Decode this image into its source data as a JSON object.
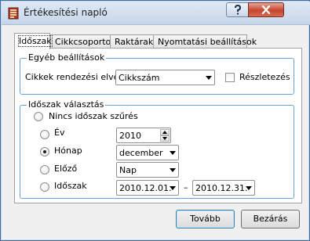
{
  "window": {
    "title": "Értékesítési napló"
  },
  "tabs": [
    {
      "label": "Időszak"
    },
    {
      "label": "Cikkcsoportok"
    },
    {
      "label": "Raktárak"
    },
    {
      "label": "Nyomtatási beállítások"
    }
  ],
  "other_settings": {
    "title": "Egyéb beállítások",
    "sort_label": "Cikkek rendezési elve :",
    "sort_value": "Cikkszám",
    "detail_label": "Részletezés",
    "detail_checked": false
  },
  "period": {
    "title": "Időszak választás",
    "no_filter_label": "Nincs időszak szűrés",
    "year_label": "Év",
    "year_value": "2010",
    "month_label": "Hónap",
    "month_value": "december",
    "previous_label": "Előző",
    "previous_value": "Nap",
    "range_label": "Időszak",
    "range_from": "2010.12.01.",
    "range_to": "2010.12.31.",
    "range_separator": "–",
    "selected": "Hónap"
  },
  "buttons": {
    "next": "Tovább",
    "close": "Bezárás"
  },
  "colors": {
    "group_border": "#6ba2d6",
    "title_gradient_top": "#dfe9f5",
    "close_button": "#c6452f"
  }
}
